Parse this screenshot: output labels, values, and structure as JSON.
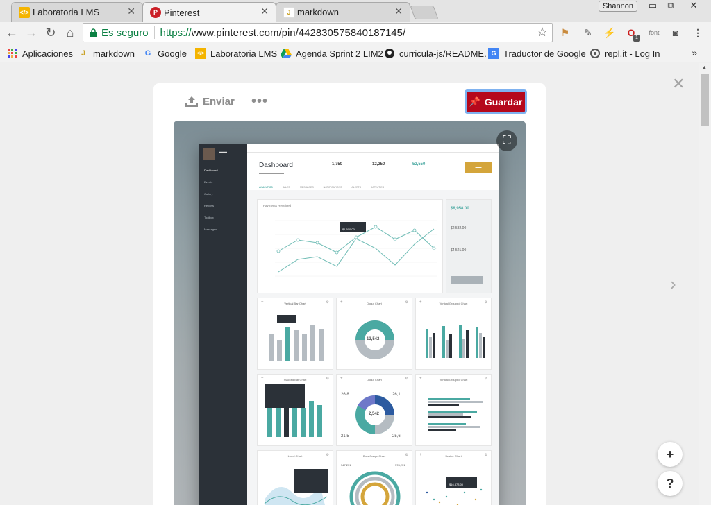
{
  "browser": {
    "tabs": [
      {
        "title": "Laboratoria LMS",
        "favicon_color": "#f4b400",
        "favicon_glyph": "</>",
        "active": false
      },
      {
        "title": "Pinterest",
        "favicon_color": "#cb2027",
        "favicon_glyph": "P",
        "active": true
      },
      {
        "title": "markdown",
        "favicon_color": "#c9a227",
        "favicon_glyph": "J",
        "active": false
      }
    ],
    "profile_name": "Shannon",
    "window_controls": {
      "minimize": "▭",
      "restore": "⧉",
      "close": "✕"
    },
    "security_label": "Es seguro",
    "url_scheme": "https://",
    "url_rest": "www.pinterest.com/pin/442830575840187145/",
    "extensions": [
      "bookmark-icon",
      "eyedropper-icon",
      "lightning-icon",
      "opera-icon",
      "font-icon",
      "camera-icon"
    ],
    "font_ext_label": "font",
    "opera_badge": "1",
    "bookmarks": [
      {
        "label": "Aplicaciones",
        "icon": "apps-grid-icon"
      },
      {
        "label": "markdown",
        "icon": "markdown-icon"
      },
      {
        "label": "Google",
        "icon": "google-icon"
      },
      {
        "label": "Laboratoria LMS",
        "icon": "laboratoria-icon"
      },
      {
        "label": "Agenda Sprint 2 LIM2",
        "icon": "drive-icon"
      },
      {
        "label": "curricula-js/README.",
        "icon": "github-icon"
      },
      {
        "label": "Traductor de Google",
        "icon": "translate-icon"
      },
      {
        "label": "repl.it - Log In",
        "icon": "replit-icon"
      }
    ],
    "bookmarks_more": "»"
  },
  "pin": {
    "send_label": "Enviar",
    "more_label": "•••",
    "save_label": "Guardar",
    "accent_color": "#b5081c"
  },
  "dashboard": {
    "title": "Dashboard",
    "nav": [
      "Dashboard",
      "Events",
      "Gallery",
      "Reports",
      "Toolbox",
      "Messages"
    ],
    "stats": [
      {
        "value": "1,750"
      },
      {
        "value": "12,250"
      },
      {
        "value": "52,550"
      }
    ],
    "tabs": [
      "ANALYTICS",
      "SALES",
      "MESSAGES",
      "NOTIFICATIONS",
      "ALERTS",
      "ACTIVITIES"
    ],
    "payments_title": "Payments Received",
    "tooltip_value": "$1,500.00",
    "total_income": "$8,958.00",
    "income_2": "$2,582.00",
    "income_3": "$4,521.00",
    "panels": [
      "Vertical Bar Chart",
      "Donut Chart",
      "Vertical Grouped Chart",
      "Stacked Bar Chart",
      "Donut Chart",
      "Vertical Grouped Chart",
      "Lined Chart",
      "Bars Gauge Chart",
      "Scatter Chart"
    ],
    "donut1_center": "13,542",
    "donut2_center": "2,542",
    "donut2_labels": [
      "26,8",
      "26,1",
      "21,5",
      "25,6"
    ],
    "bar_tooltip": "$1,873,00",
    "gauge_labels": [
      "$47,231",
      "$78,231"
    ],
    "scatter_tooltip": "$16,873,00",
    "accent_teal": "#4aa9a2",
    "accent_gold": "#d4a53b"
  },
  "page_controls": {
    "close": "✕",
    "next": "›",
    "add": "+",
    "help": "?"
  }
}
